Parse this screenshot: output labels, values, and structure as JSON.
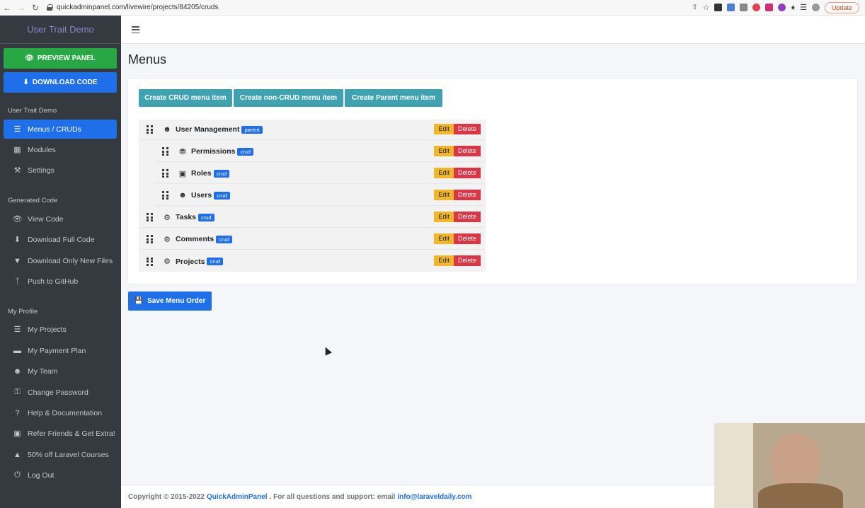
{
  "browser": {
    "url": "quickadminpanel.com/livewire/projects/84205/cruds",
    "update_label": "Update"
  },
  "sidebar": {
    "brand": "User Trait Demo",
    "preview_label": "PREVIEW PANEL",
    "download_label": "DOWNLOAD CODE",
    "section1": "User Trait Demo",
    "items1": [
      {
        "label": "Menus / CRUDs",
        "icon": "list-icon"
      },
      {
        "label": "Modules",
        "icon": "cubes-icon"
      },
      {
        "label": "Settings",
        "icon": "wrench-icon"
      }
    ],
    "section2": "Generated Code",
    "items2": [
      {
        "label": "View Code",
        "icon": "eye-icon"
      },
      {
        "label": "Download Full Code",
        "icon": "download-icon"
      },
      {
        "label": "Download Only New Files",
        "icon": "arrow-circle-down-icon"
      },
      {
        "label": "Push to GitHub",
        "icon": "code-branch-icon"
      }
    ],
    "section3": "My Profile",
    "items3": [
      {
        "label": "My Projects",
        "icon": "list-icon"
      },
      {
        "label": "My Payment Plan",
        "icon": "credit-card-icon"
      },
      {
        "label": "My Team",
        "icon": "users-icon"
      },
      {
        "label": "Change Password",
        "icon": "key-icon"
      },
      {
        "label": "Help & Documentation",
        "icon": "question-circle-icon"
      },
      {
        "label": "Refer Friends & Get Extra!",
        "icon": "gift-icon"
      },
      {
        "label": "50% off Laravel Courses",
        "icon": "graduation-cap-icon"
      },
      {
        "label": "Log Out",
        "icon": "power-icon"
      }
    ]
  },
  "main": {
    "title": "Menus",
    "buttons": {
      "crud": "Create CRUD menu item",
      "noncrud": "Create non-CRUD menu item",
      "parent": "Create Parent menu item"
    },
    "edit_label": "Edit",
    "delete_label": "Delete",
    "menu_items": [
      {
        "name": "User Management",
        "badge": "parent",
        "icon": "users-icon"
      },
      {
        "name": "Permissions",
        "badge": "crud",
        "icon": "unlock-icon"
      },
      {
        "name": "Roles",
        "badge": "crud",
        "icon": "briefcase-icon"
      },
      {
        "name": "Users",
        "badge": "crud",
        "icon": "user-icon"
      },
      {
        "name": "Tasks",
        "badge": "crud",
        "icon": "cogs-icon"
      },
      {
        "name": "Comments",
        "badge": "crud",
        "icon": "cogs-icon"
      },
      {
        "name": "Projects",
        "badge": "crud",
        "icon": "cogs-icon"
      }
    ],
    "save_label": "Save Menu Order"
  },
  "footer": {
    "prefix": "Copyright © 2015-2022",
    "brand": "QuickAdminPanel",
    "middle": ". For all questions and support: email",
    "email": "info@laraveldaily.com"
  }
}
